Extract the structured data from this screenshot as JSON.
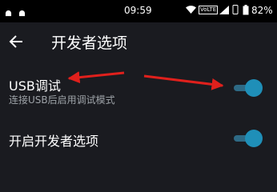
{
  "status_bar": {
    "time": "09:59",
    "network": "VoLTE",
    "battery": "82%"
  },
  "header": {
    "title": "开发者选项",
    "back_icon": "arrow-left-icon"
  },
  "settings": [
    {
      "title": "USB调试",
      "subtitle": "连接USB后启用调试模式",
      "enabled": true
    },
    {
      "title": "开启开发者选项",
      "enabled": true
    }
  ],
  "colors": {
    "background": "#1a1b20",
    "accent": "#1f8fb8",
    "track": "#2e6a85",
    "annotation": "#e0201c"
  }
}
